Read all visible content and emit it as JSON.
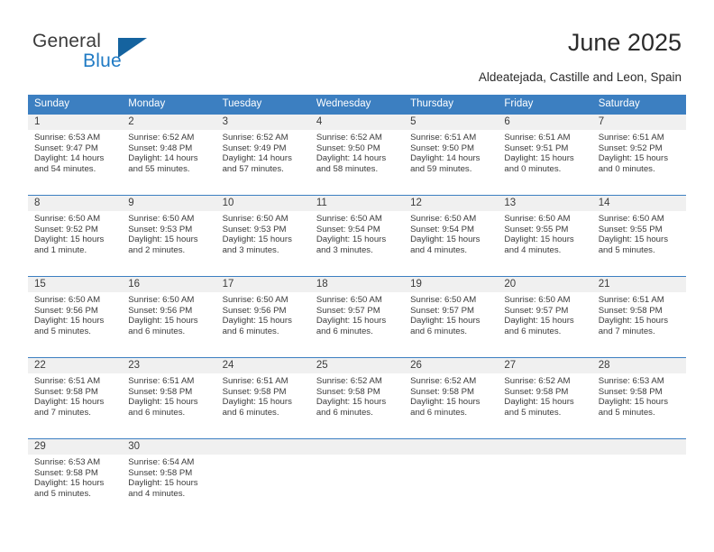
{
  "logo": {
    "primary_text": "General",
    "secondary_text": "Blue",
    "triangle_icon": "blue-triangle-icon",
    "primary_color": "#3b3b3b",
    "secondary_color": "#1f7ac4"
  },
  "header": {
    "title": "June 2025",
    "subtitle": "Aldeatejada, Castille and Leon, Spain"
  },
  "theme": {
    "header_bg": "#3c7fc1",
    "header_text": "#ffffff",
    "daynum_band_bg": "#f0f0f0",
    "row_divider": "#3c7fc1",
    "body_text": "#3b3b3b"
  },
  "calendar": {
    "weekdays": [
      "Sunday",
      "Monday",
      "Tuesday",
      "Wednesday",
      "Thursday",
      "Friday",
      "Saturday"
    ],
    "weeks": [
      [
        {
          "day": "1",
          "sunrise": "Sunrise: 6:53 AM",
          "sunset": "Sunset: 9:47 PM",
          "daylight_1": "Daylight: 14 hours",
          "daylight_2": "and 54 minutes."
        },
        {
          "day": "2",
          "sunrise": "Sunrise: 6:52 AM",
          "sunset": "Sunset: 9:48 PM",
          "daylight_1": "Daylight: 14 hours",
          "daylight_2": "and 55 minutes."
        },
        {
          "day": "3",
          "sunrise": "Sunrise: 6:52 AM",
          "sunset": "Sunset: 9:49 PM",
          "daylight_1": "Daylight: 14 hours",
          "daylight_2": "and 57 minutes."
        },
        {
          "day": "4",
          "sunrise": "Sunrise: 6:52 AM",
          "sunset": "Sunset: 9:50 PM",
          "daylight_1": "Daylight: 14 hours",
          "daylight_2": "and 58 minutes."
        },
        {
          "day": "5",
          "sunrise": "Sunrise: 6:51 AM",
          "sunset": "Sunset: 9:50 PM",
          "daylight_1": "Daylight: 14 hours",
          "daylight_2": "and 59 minutes."
        },
        {
          "day": "6",
          "sunrise": "Sunrise: 6:51 AM",
          "sunset": "Sunset: 9:51 PM",
          "daylight_1": "Daylight: 15 hours",
          "daylight_2": "and 0 minutes."
        },
        {
          "day": "7",
          "sunrise": "Sunrise: 6:51 AM",
          "sunset": "Sunset: 9:52 PM",
          "daylight_1": "Daylight: 15 hours",
          "daylight_2": "and 0 minutes."
        }
      ],
      [
        {
          "day": "8",
          "sunrise": "Sunrise: 6:50 AM",
          "sunset": "Sunset: 9:52 PM",
          "daylight_1": "Daylight: 15 hours",
          "daylight_2": "and 1 minute."
        },
        {
          "day": "9",
          "sunrise": "Sunrise: 6:50 AM",
          "sunset": "Sunset: 9:53 PM",
          "daylight_1": "Daylight: 15 hours",
          "daylight_2": "and 2 minutes."
        },
        {
          "day": "10",
          "sunrise": "Sunrise: 6:50 AM",
          "sunset": "Sunset: 9:53 PM",
          "daylight_1": "Daylight: 15 hours",
          "daylight_2": "and 3 minutes."
        },
        {
          "day": "11",
          "sunrise": "Sunrise: 6:50 AM",
          "sunset": "Sunset: 9:54 PM",
          "daylight_1": "Daylight: 15 hours",
          "daylight_2": "and 3 minutes."
        },
        {
          "day": "12",
          "sunrise": "Sunrise: 6:50 AM",
          "sunset": "Sunset: 9:54 PM",
          "daylight_1": "Daylight: 15 hours",
          "daylight_2": "and 4 minutes."
        },
        {
          "day": "13",
          "sunrise": "Sunrise: 6:50 AM",
          "sunset": "Sunset: 9:55 PM",
          "daylight_1": "Daylight: 15 hours",
          "daylight_2": "and 4 minutes."
        },
        {
          "day": "14",
          "sunrise": "Sunrise: 6:50 AM",
          "sunset": "Sunset: 9:55 PM",
          "daylight_1": "Daylight: 15 hours",
          "daylight_2": "and 5 minutes."
        }
      ],
      [
        {
          "day": "15",
          "sunrise": "Sunrise: 6:50 AM",
          "sunset": "Sunset: 9:56 PM",
          "daylight_1": "Daylight: 15 hours",
          "daylight_2": "and 5 minutes."
        },
        {
          "day": "16",
          "sunrise": "Sunrise: 6:50 AM",
          "sunset": "Sunset: 9:56 PM",
          "daylight_1": "Daylight: 15 hours",
          "daylight_2": "and 6 minutes."
        },
        {
          "day": "17",
          "sunrise": "Sunrise: 6:50 AM",
          "sunset": "Sunset: 9:56 PM",
          "daylight_1": "Daylight: 15 hours",
          "daylight_2": "and 6 minutes."
        },
        {
          "day": "18",
          "sunrise": "Sunrise: 6:50 AM",
          "sunset": "Sunset: 9:57 PM",
          "daylight_1": "Daylight: 15 hours",
          "daylight_2": "and 6 minutes."
        },
        {
          "day": "19",
          "sunrise": "Sunrise: 6:50 AM",
          "sunset": "Sunset: 9:57 PM",
          "daylight_1": "Daylight: 15 hours",
          "daylight_2": "and 6 minutes."
        },
        {
          "day": "20",
          "sunrise": "Sunrise: 6:50 AM",
          "sunset": "Sunset: 9:57 PM",
          "daylight_1": "Daylight: 15 hours",
          "daylight_2": "and 6 minutes."
        },
        {
          "day": "21",
          "sunrise": "Sunrise: 6:51 AM",
          "sunset": "Sunset: 9:58 PM",
          "daylight_1": "Daylight: 15 hours",
          "daylight_2": "and 7 minutes."
        }
      ],
      [
        {
          "day": "22",
          "sunrise": "Sunrise: 6:51 AM",
          "sunset": "Sunset: 9:58 PM",
          "daylight_1": "Daylight: 15 hours",
          "daylight_2": "and 7 minutes."
        },
        {
          "day": "23",
          "sunrise": "Sunrise: 6:51 AM",
          "sunset": "Sunset: 9:58 PM",
          "daylight_1": "Daylight: 15 hours",
          "daylight_2": "and 6 minutes."
        },
        {
          "day": "24",
          "sunrise": "Sunrise: 6:51 AM",
          "sunset": "Sunset: 9:58 PM",
          "daylight_1": "Daylight: 15 hours",
          "daylight_2": "and 6 minutes."
        },
        {
          "day": "25",
          "sunrise": "Sunrise: 6:52 AM",
          "sunset": "Sunset: 9:58 PM",
          "daylight_1": "Daylight: 15 hours",
          "daylight_2": "and 6 minutes."
        },
        {
          "day": "26",
          "sunrise": "Sunrise: 6:52 AM",
          "sunset": "Sunset: 9:58 PM",
          "daylight_1": "Daylight: 15 hours",
          "daylight_2": "and 6 minutes."
        },
        {
          "day": "27",
          "sunrise": "Sunrise: 6:52 AM",
          "sunset": "Sunset: 9:58 PM",
          "daylight_1": "Daylight: 15 hours",
          "daylight_2": "and 5 minutes."
        },
        {
          "day": "28",
          "sunrise": "Sunrise: 6:53 AM",
          "sunset": "Sunset: 9:58 PM",
          "daylight_1": "Daylight: 15 hours",
          "daylight_2": "and 5 minutes."
        }
      ],
      [
        {
          "day": "29",
          "sunrise": "Sunrise: 6:53 AM",
          "sunset": "Sunset: 9:58 PM",
          "daylight_1": "Daylight: 15 hours",
          "daylight_2": "and 5 minutes."
        },
        {
          "day": "30",
          "sunrise": "Sunrise: 6:54 AM",
          "sunset": "Sunset: 9:58 PM",
          "daylight_1": "Daylight: 15 hours",
          "daylight_2": "and 4 minutes."
        },
        {
          "day": "",
          "sunrise": "",
          "sunset": "",
          "daylight_1": "",
          "daylight_2": ""
        },
        {
          "day": "",
          "sunrise": "",
          "sunset": "",
          "daylight_1": "",
          "daylight_2": ""
        },
        {
          "day": "",
          "sunrise": "",
          "sunset": "",
          "daylight_1": "",
          "daylight_2": ""
        },
        {
          "day": "",
          "sunrise": "",
          "sunset": "",
          "daylight_1": "",
          "daylight_2": ""
        },
        {
          "day": "",
          "sunrise": "",
          "sunset": "",
          "daylight_1": "",
          "daylight_2": ""
        }
      ]
    ]
  }
}
